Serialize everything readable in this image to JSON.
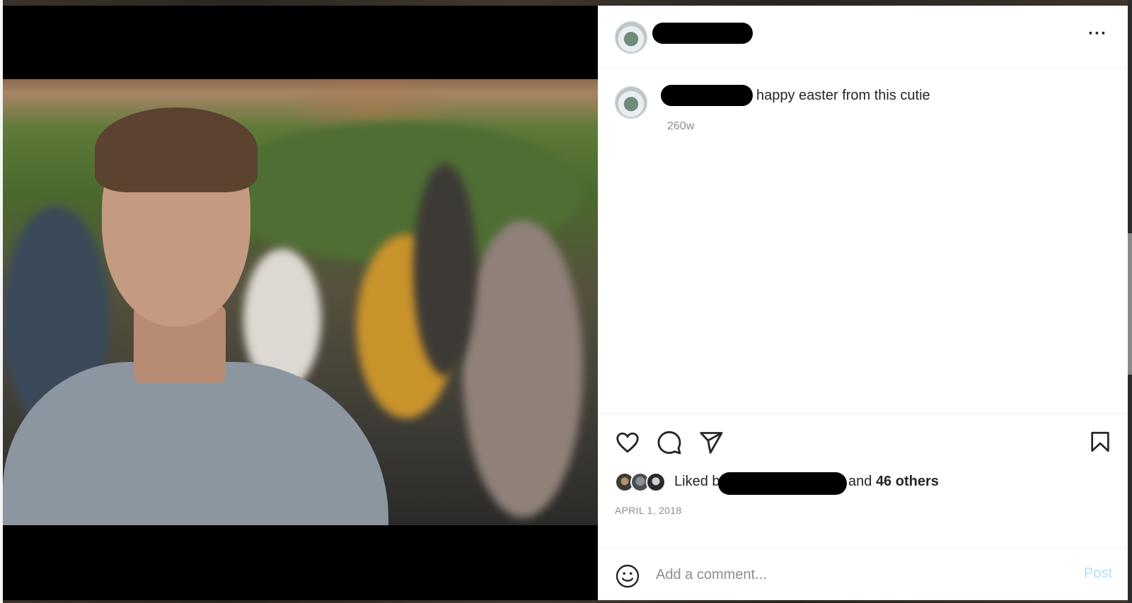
{
  "post": {
    "caption": "happy easter from this cutie",
    "age": "260w",
    "likes_prefix": "Liked by",
    "likes_and": "and",
    "likes_count": "46 others",
    "date": "APRIL 1, 2018",
    "more_glyph": "···"
  },
  "comment": {
    "placeholder": "Add a comment...",
    "post_label": "Post"
  },
  "icons": {
    "like": "heart-icon",
    "comment": "comment-icon",
    "share": "paper-plane-icon",
    "save": "bookmark-icon",
    "emoji": "smiley-icon",
    "more": "more-options-icon"
  },
  "colors": {
    "post_button_disabled": "#b2dffc",
    "text_primary": "#262626",
    "text_secondary": "#8e8e8e"
  }
}
